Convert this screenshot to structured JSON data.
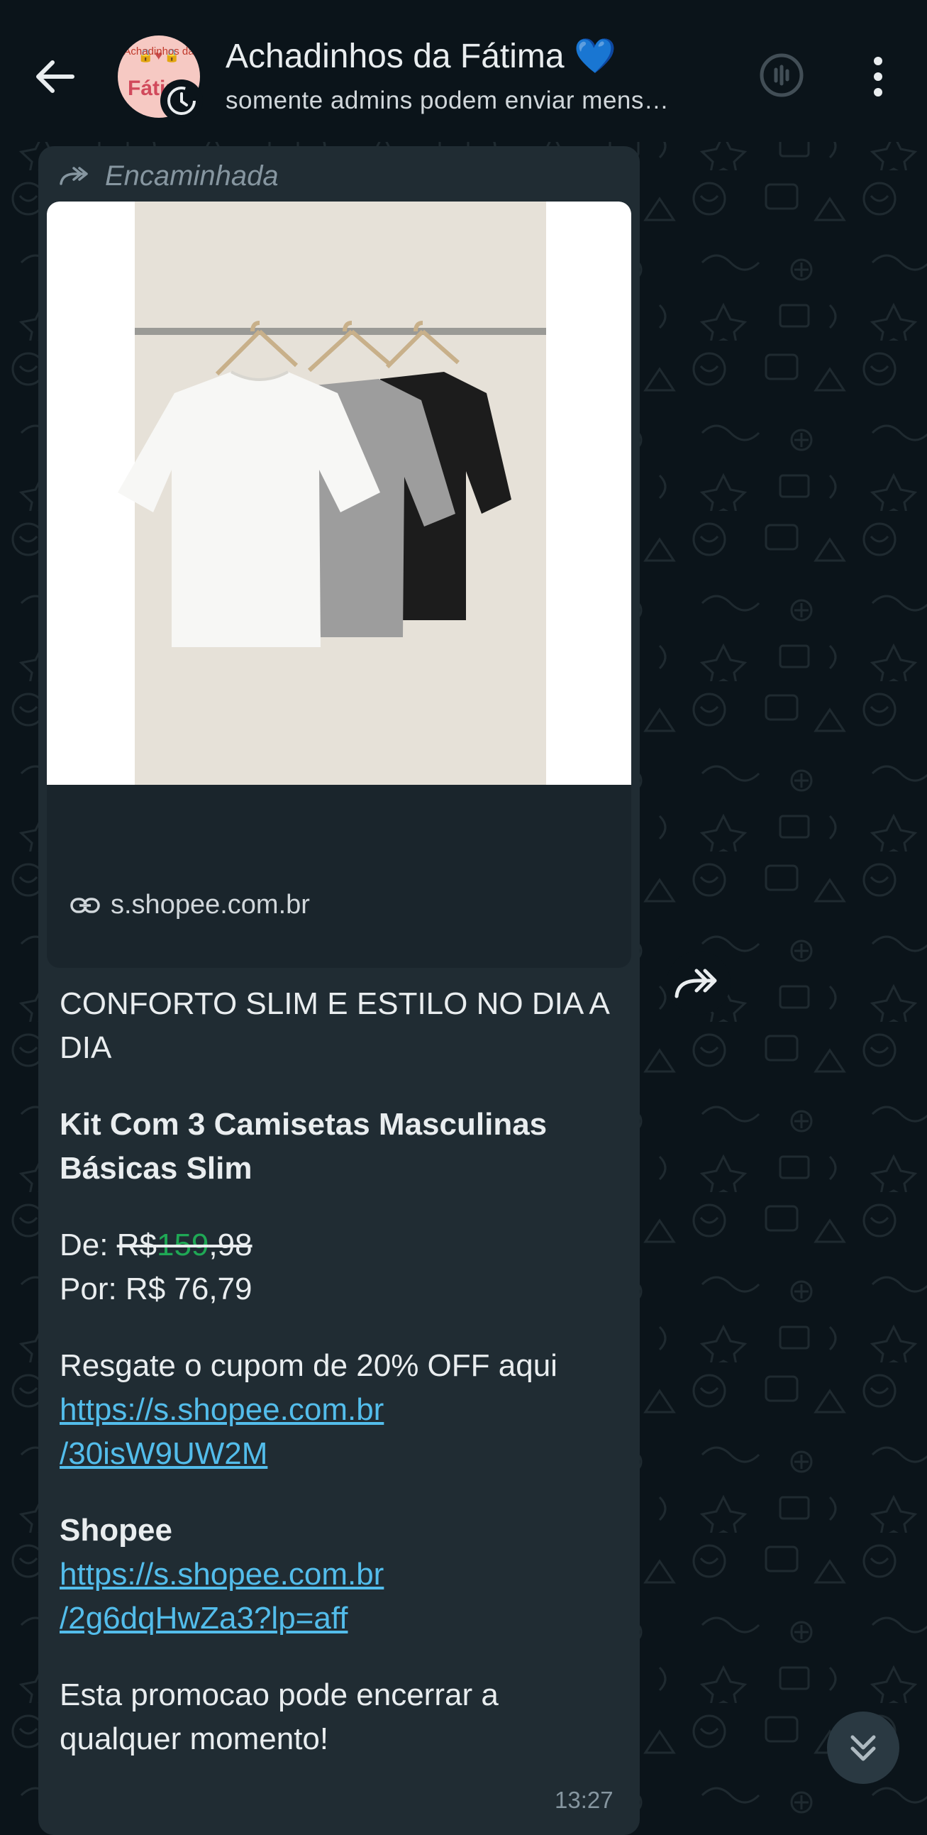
{
  "header": {
    "title": "Achadinhos da Fátima",
    "title_emoji": "💙",
    "subtitle": "somente admins podem enviar mens…",
    "avatar_text_top": "Achadinhos da",
    "avatar_text_main": "Fátim",
    "icons": [
      "back-arrow-icon",
      "voice-chat-icon",
      "more-vert-icon"
    ]
  },
  "message": {
    "forwarded_label": "Encaminhada",
    "link_preview_domain": "s.shopee.com.br",
    "headline": "CONFORTO SLIM E ESTILO NO DIA A DIA",
    "product_name": "Kit Com 3 Camisetas Masculinas Básicas Slim",
    "price_from_label": "De:",
    "price_from_currency": "R$",
    "price_from_int": "159",
    "price_from_dec": ",98",
    "price_to": "Por: R$ 76,79",
    "coupon_text": "Resgate o cupom de 20% OFF aqui",
    "coupon_link_line1": "https://s.shopee.com.br",
    "coupon_link_line2": "/30isW9UW2M",
    "store_name": "Shopee",
    "store_link_line1": "https://s.shopee.com.br",
    "store_link_line2": "/2g6dqHwZa3?lp=aff",
    "footer": "Esta promocao pode encerrar a qualquer momento!",
    "time": "13:27"
  },
  "colors": {
    "background": "#0b141a",
    "bubble": "#202c33",
    "link": "#53bdeb",
    "strike_green": "#1fa855",
    "heart": "#3b95e6"
  }
}
